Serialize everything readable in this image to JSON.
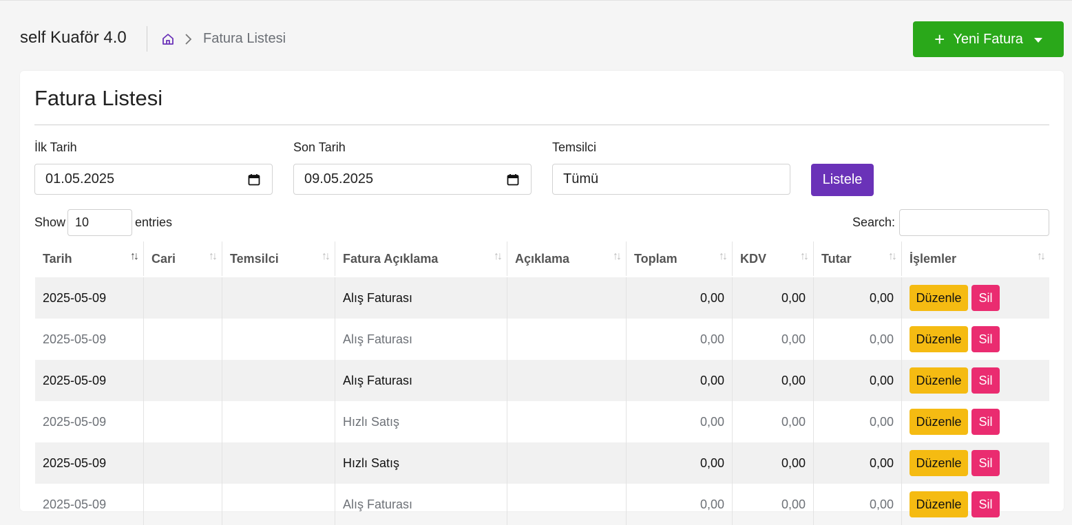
{
  "app_title": "self Kuaför 4.0",
  "breadcrumb": {
    "current": "Fatura Listesi"
  },
  "new_invoice_button": "Yeni Fatura",
  "card_title": "Fatura Listesi",
  "filters": {
    "start_label": "İlk Tarih",
    "start_value": "01.05.2025",
    "end_label": "Son Tarih",
    "end_value": "09.05.2025",
    "rep_label": "Temsilci",
    "rep_value": "Tümü",
    "list_button": "Listele"
  },
  "datatable": {
    "show_label": "Show",
    "page_size": "10",
    "entries_label": "entries",
    "search_label": "Search:",
    "columns": [
      "Tarih",
      "Cari",
      "Temsilci",
      "Fatura Açıklama",
      "Açıklama",
      "Toplam",
      "KDV",
      "Tutar",
      "İşlemler"
    ],
    "sorted_column": "Tarih",
    "rows": [
      {
        "tarih": "2025-05-09",
        "cari": "",
        "temsilci": "",
        "fatura_aciklama": "Alış Faturası",
        "aciklama": "",
        "toplam": "0,00",
        "kdv": "0,00",
        "tutar": "0,00"
      },
      {
        "tarih": "2025-05-09",
        "cari": "",
        "temsilci": "",
        "fatura_aciklama": "Alış Faturası",
        "aciklama": "",
        "toplam": "0,00",
        "kdv": "0,00",
        "tutar": "0,00"
      },
      {
        "tarih": "2025-05-09",
        "cari": "",
        "temsilci": "",
        "fatura_aciklama": "Alış Faturası",
        "aciklama": "",
        "toplam": "0,00",
        "kdv": "0,00",
        "tutar": "0,00"
      },
      {
        "tarih": "2025-05-09",
        "cari": "",
        "temsilci": "",
        "fatura_aciklama": "Hızlı Satış",
        "aciklama": "",
        "toplam": "0,00",
        "kdv": "0,00",
        "tutar": "0,00"
      },
      {
        "tarih": "2025-05-09",
        "cari": "",
        "temsilci": "",
        "fatura_aciklama": "Hızlı Satış",
        "aciklama": "",
        "toplam": "0,00",
        "kdv": "0,00",
        "tutar": "0,00"
      },
      {
        "tarih": "2025-05-09",
        "cari": "",
        "temsilci": "",
        "fatura_aciklama": "Alış Faturası",
        "aciklama": "",
        "toplam": "0,00",
        "kdv": "0,00",
        "tutar": "0,00"
      }
    ],
    "edit_label": "Düzenle",
    "delete_label": "Sil"
  },
  "colors": {
    "accent_green": "#2aa81a",
    "accent_purple": "#6a32b8",
    "edit_yellow": "#f5bb12",
    "delete_pink": "#ea2c70"
  }
}
